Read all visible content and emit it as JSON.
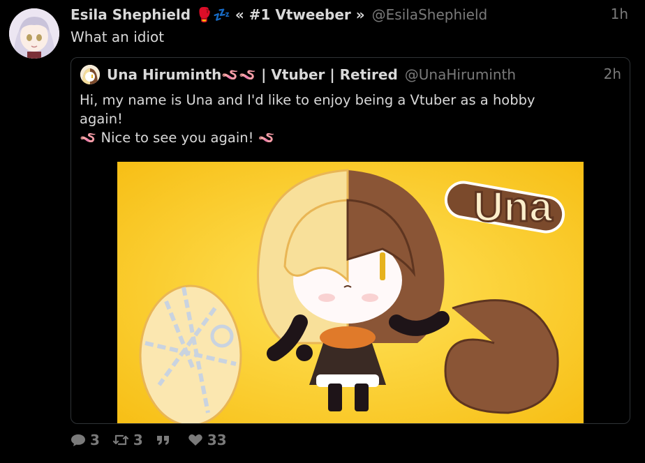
{
  "post": {
    "author_name": "Esila Shephield",
    "author_emoji": "🥊💤",
    "author_suffix": "« #1 Vtweeber »",
    "handle": "@EsilaShephield",
    "time": "1h",
    "text": "What an idiot"
  },
  "quote": {
    "author_name": "Una Hiruminth🪱🪱 | Vtuber | Retired",
    "handle": "@UnaHiruminth",
    "time": "2h",
    "text_lines": [
      "Hi, my name is Una and I'd like to enjoy being a Vtuber as a hobby",
      "again!",
      "🪱 Nice to see you again! 🪱"
    ],
    "image_logo_text": "Una"
  },
  "actions": {
    "replies": "3",
    "reposts": "3",
    "quotes_label": "",
    "likes": "33"
  },
  "colors": {
    "background": "#000000",
    "text": "#d9d9d9",
    "muted": "#7a7a7a",
    "border": "#2f3336",
    "media_bg": "#ffd23a"
  }
}
